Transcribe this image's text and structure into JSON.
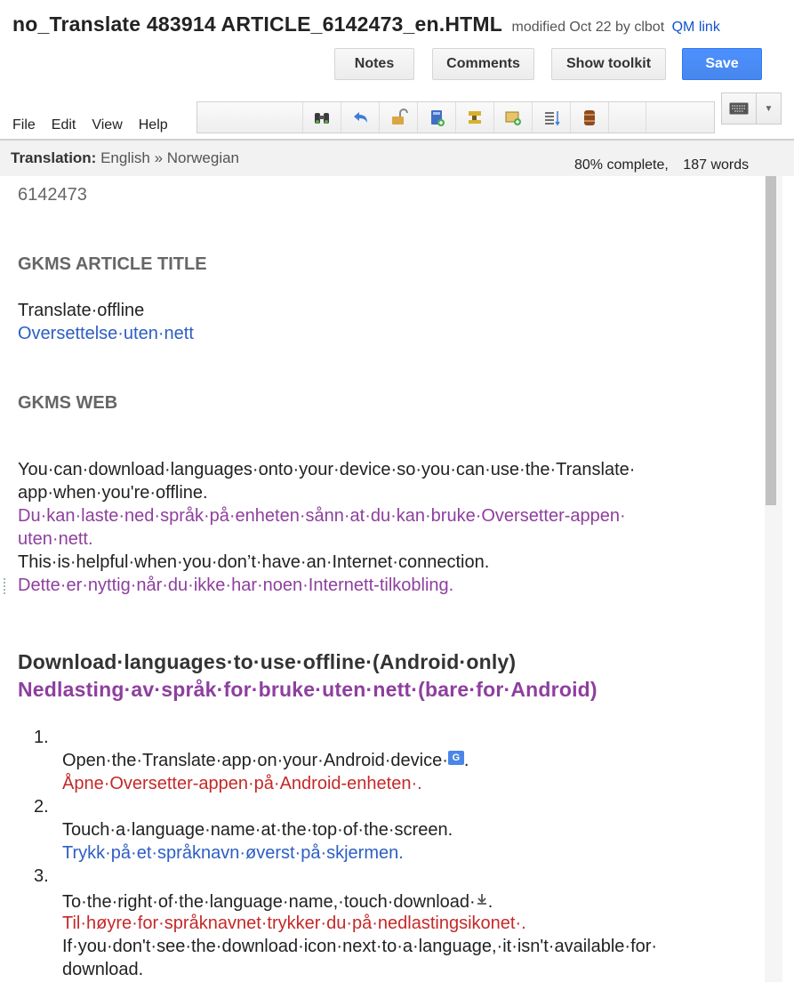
{
  "header": {
    "doc_title": "no_Translate 483914 ARTICLE_6142473_en.HTML",
    "modified": "modified Oct 22 by clbot",
    "qm_link": "QM link"
  },
  "buttons": {
    "notes": "Notes",
    "comments": "Comments",
    "show_toolkit": "Show toolkit",
    "save": "Save"
  },
  "menu": [
    "File",
    "Edit",
    "View",
    "Help"
  ],
  "toolbar_icons": [
    "binoculars-icon",
    "undo-icon",
    "unlock-icon",
    "book-icon",
    "puzzle-icon",
    "add-image-icon",
    "sort-lines-icon",
    "barrel-icon"
  ],
  "translation": {
    "label": "Translation:",
    "langs": "English » Norwegian",
    "progress": "80% complete,",
    "words": "187 words"
  },
  "content": {
    "article_id": "6142473",
    "heading_title": "GKMS ARTICLE TITLE",
    "title_src": "Translate·offline",
    "title_tgt": "Oversettelse·uten·nett",
    "heading_web": "GKMS WEB",
    "p1_src_a": "You·can·download·languages·onto·your·device·so·you·can·use·the·Translate·",
    "p1_src_b": " app·when·you're·offline.",
    "p1_tgt_a": "Du·kan·laste·ned·språk·på·enheten·sånn·at·du·kan·bruke·Oversetter-appen·",
    "p1_tgt_b": "uten·nett.",
    "p2_src": "This·is·helpful·when·you·don’t·have·an·Internet·connection.",
    "p2_tgt": "Dette·er·nyttig·når·du·ikke·har·noen·Internett-tilkobling.",
    "h2_src": "Download·languages·to·use·offline·(Android·only)",
    "h2_tgt": "Nedlasting·av·språk·for·bruke·uten·nett·(bare·for·Android)",
    "n1": "1.",
    "s1_src": "Open·the·Translate·app·on·your·Android·device·",
    "s1_src_end": ".",
    "s1_tgt": "Åpne·Oversetter-appen·på·Android-enheten·.",
    "n2": "2.",
    "s2_src": "Touch·a·language·name·at·the·top·of·the·screen.",
    "s2_tgt": "Trykk·på·et·språknavn·øverst·på·skjermen.",
    "n3": "3.",
    "s3_src": "To·the·right·of·the·language·name,·touch·download·",
    "s3_src_end": ".",
    "s3_tgt": "Til·høyre·for·språknavnet·trykker·du·på·nedlastingsikonet·.",
    "s3_note_a": "If·you·don't·see·the·download·icon·next·to·a·language,·it·isn't·available·for·",
    "s3_note_b": " download."
  }
}
